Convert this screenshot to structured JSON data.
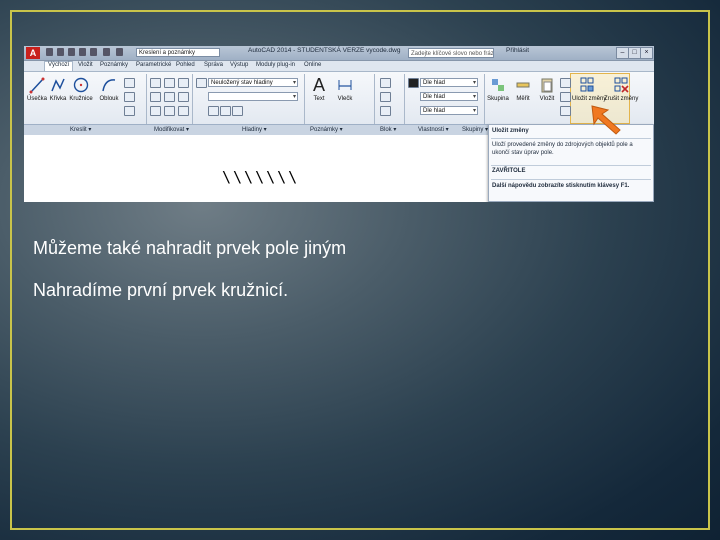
{
  "app": {
    "logo": "A",
    "workspace": "Kreslení a poznámky",
    "document_title": "AutoCAD 2014 - STUDENTSKÁ VERZE  vycode.dwg",
    "help_search_placeholder": "Zadejte klíčové slovo nebo frázi",
    "login": "Přihlásit"
  },
  "tabs": [
    "Výchozí",
    "Vložit",
    "Poznámky",
    "Parametrické",
    "Pohled",
    "Správa",
    "Výstup",
    "Moduly plug-in",
    "Online"
  ],
  "ribbon": {
    "draw_tools": [
      "Úsečka",
      "Křivka",
      "Kružnice",
      "Oblouk"
    ],
    "layer_state": "Neuložený stav hladiny",
    "text_label": "Text",
    "dim_label": "Vlečk",
    "prop_color": "Dle hlad",
    "prop_linetype": "Dle hlad",
    "prop_lineweight": "Dle hlad",
    "group_label": "Skupina",
    "measure_label": "Měřit",
    "paste_label": "Vložit",
    "save_changes_label": "Uložit změny",
    "discard_changes_label": "Zrušit změny"
  },
  "panels": [
    "Kreslit ▾",
    "Modifikovat ▾",
    "Hladiny ▾",
    "Poznámky ▾",
    "Blok ▾",
    "Vlastnosti ▾",
    "Skupiny ▾"
  ],
  "tooltip": {
    "title": "Uložit změny",
    "body": "Uloží provedené změny do zdrojových objektů pole a ukončí stav úprav pole.",
    "command": "ZAVŘITOLE",
    "more": "Další nápovědu zobrazíte stisknutím klávesy F1."
  },
  "canvas": {
    "hatch": "\\\\\\\\\\\\\\"
  },
  "slide": {
    "line1": "Můžeme také nahradit prvek pole jiným",
    "line2": "Nahradíme první prvek kružnicí."
  },
  "colors": {
    "frame": "#c9c44a",
    "arrow": "#f07820",
    "text": "#ffffff"
  }
}
